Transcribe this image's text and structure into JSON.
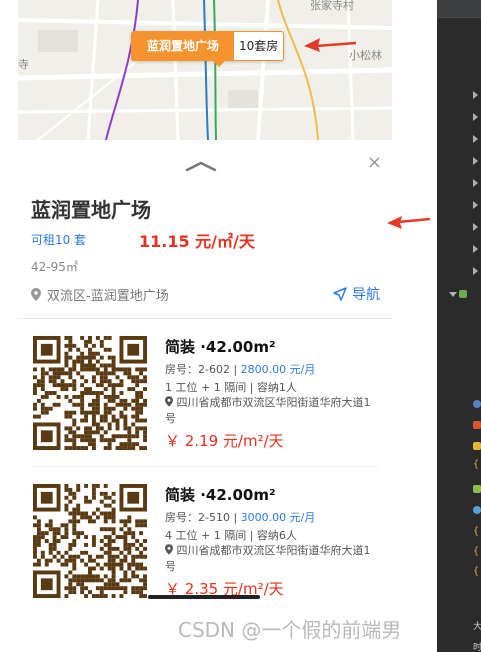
{
  "map": {
    "labels": {
      "top_right": "张家寺村",
      "right": "小松林",
      "left": "寺"
    },
    "marker": {
      "name": "蓝润置地广场",
      "count": "10套房"
    }
  },
  "detail": {
    "title": "蓝润置地广场",
    "rent_count": "可租10 套",
    "price": "11.15 元/㎡/天",
    "area_range": "42-95㎡",
    "address": "双流区-蓝润置地广场",
    "nav_label": "导航",
    "close_symbol": "×"
  },
  "listings": [
    {
      "title": "简装 ·42.00m²",
      "room_prefix": "房号：2-602 | ",
      "monthly": "2800.00 元/月",
      "layout": "1 工位 + 1 隔间 | 容纳1人",
      "address": "四川省成都市双流区华阳街道华府大道1号",
      "price": "￥ 2.19 元/m²/天"
    },
    {
      "title": "简装 ·42.00m²",
      "room_prefix": "房号：2-510 | ",
      "monthly": "3000.00 元/月",
      "layout": "4 工位 + 1 隔间 | 容纳6人",
      "address": "四川省成都市双流区华阳街道华府大道1号",
      "price": "￥ 2.35 元/m²/天"
    }
  ],
  "devtools": {
    "label_1": "大纲",
    "label_2": "时间"
  },
  "watermark": "CSDN @一个假的前端男",
  "colors": {
    "accent_orange": "#f5942e",
    "price_red": "#e8301c",
    "link_blue": "#2a7ae2",
    "annotation_red": "#e53a2a"
  }
}
